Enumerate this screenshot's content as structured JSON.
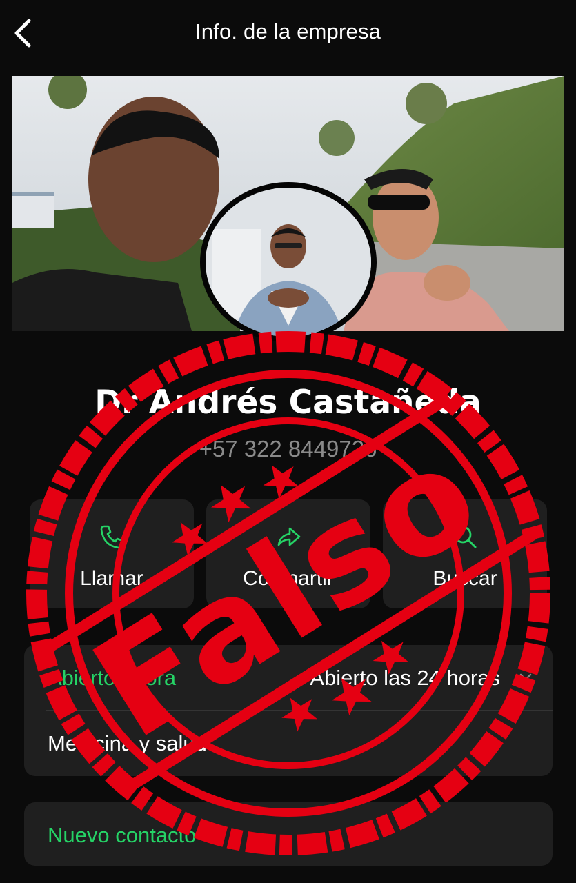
{
  "header": {
    "title": "Info. de la empresa",
    "back_icon": "chevron-left-icon"
  },
  "profile": {
    "name": "Dr Andrés Castañeda",
    "phone": "+57 322 8449726"
  },
  "actions": [
    {
      "label": "Llamar",
      "icon": "phone-icon"
    },
    {
      "label": "Compartir",
      "icon": "share-arrow-icon"
    },
    {
      "label": "Buscar",
      "icon": "search-icon"
    }
  ],
  "hours": {
    "status": "Abierto ahora",
    "detail": "Abierto las 24 horas"
  },
  "category": "Medicina y salud",
  "new_contact": "Nuevo contacto",
  "stamp": {
    "text": "Falso"
  },
  "colors": {
    "accent": "#25d366",
    "stamp": "#e50012",
    "background": "#0b0b0b",
    "card": "#1f1f1f"
  }
}
